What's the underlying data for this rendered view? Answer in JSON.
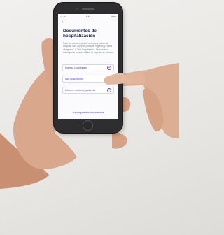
{
  "screen": {
    "status": {
      "carrier": "•••• ᯤ",
      "time": "9:41",
      "battery": "100%"
    },
    "back_icon": "back-arrow-icon",
    "title": "Documentos de hospitalización",
    "description": "Para los documentos de entrada y salida del hospital, son: Ingreso (carta de ingreso) y \"carta de egreso\" o \"alta hospitalaria\". Así nuestros subrogados podrán validar tu expediente médico.",
    "documents": [
      {
        "label": "Ingreso hospitalario",
        "icon": "add-icon"
      },
      {
        "label": "Alta hospitalaria",
        "icon": "add-icon"
      },
      {
        "label": "Informe médico (opcional)",
        "icon": "add-icon"
      }
    ],
    "footer_link": "No tengo estos documentos"
  },
  "colors": {
    "accent": "#6a4de0",
    "title": "#1e2a55",
    "wall": "#eceae7",
    "skin": "#d9a88c"
  }
}
